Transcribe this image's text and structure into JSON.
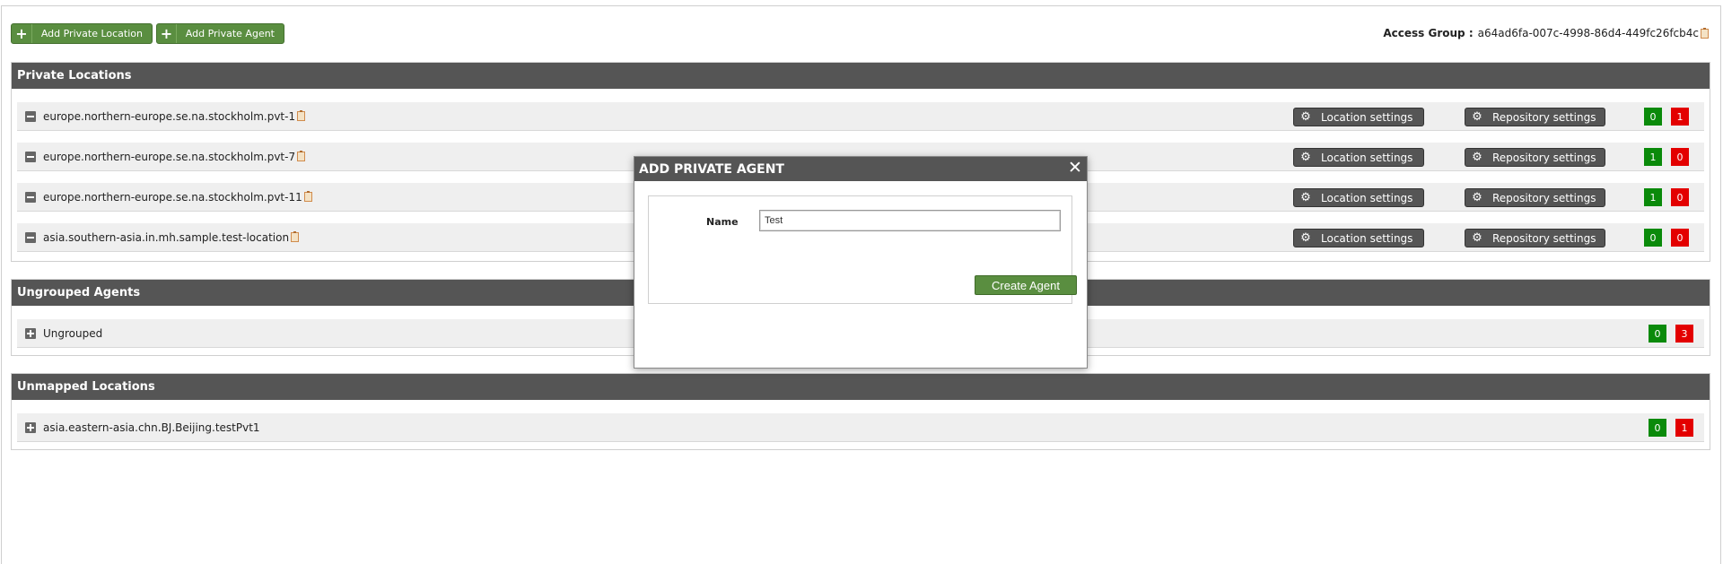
{
  "toolbar": {
    "add_location_label": "Add Private Location",
    "add_agent_label": "Add Private Agent"
  },
  "access_group": {
    "label": "Access Group :",
    "value": "a64ad6fa-007c-4998-86d4-449fc26fcb4c"
  },
  "private_locations": {
    "title": "Private Locations",
    "location_settings_label": "Location settings",
    "repository_settings_label": "Repository settings",
    "rows": [
      {
        "name": "europe.northern-europe.se.na.stockholm.pvt-1",
        "green": "0",
        "red": "1"
      },
      {
        "name": "europe.northern-europe.se.na.stockholm.pvt-7",
        "green": "1",
        "red": "0"
      },
      {
        "name": "europe.northern-europe.se.na.stockholm.pvt-11",
        "green": "1",
        "red": "0"
      },
      {
        "name": "asia.southern-asia.in.mh.sample.test-location",
        "green": "0",
        "red": "0"
      }
    ]
  },
  "ungrouped_agents": {
    "title": "Ungrouped Agents",
    "rows": [
      {
        "name": "Ungrouped",
        "green": "0",
        "red": "3"
      }
    ]
  },
  "unmapped_locations": {
    "title": "Unmapped Locations",
    "rows": [
      {
        "name": "asia.eastern-asia.chn.BJ.Beijing.testPvt1",
        "green": "0",
        "red": "1"
      }
    ]
  },
  "modal": {
    "title": "ADD PRIVATE AGENT",
    "close": "✕",
    "name_label": "Name",
    "name_value": "Test",
    "create_label": "Create Agent"
  },
  "colors": {
    "accent_green": "#5a8e40",
    "header_gray": "#555555",
    "count_green": "#0a8a0a",
    "count_red": "#e30000"
  },
  "icons": {
    "plus": "plus-icon",
    "gear": "gear-icon",
    "clipboard": "clipboard-icon",
    "collapse": "minus-square-icon",
    "expand": "plus-square-icon",
    "close": "close-icon"
  }
}
